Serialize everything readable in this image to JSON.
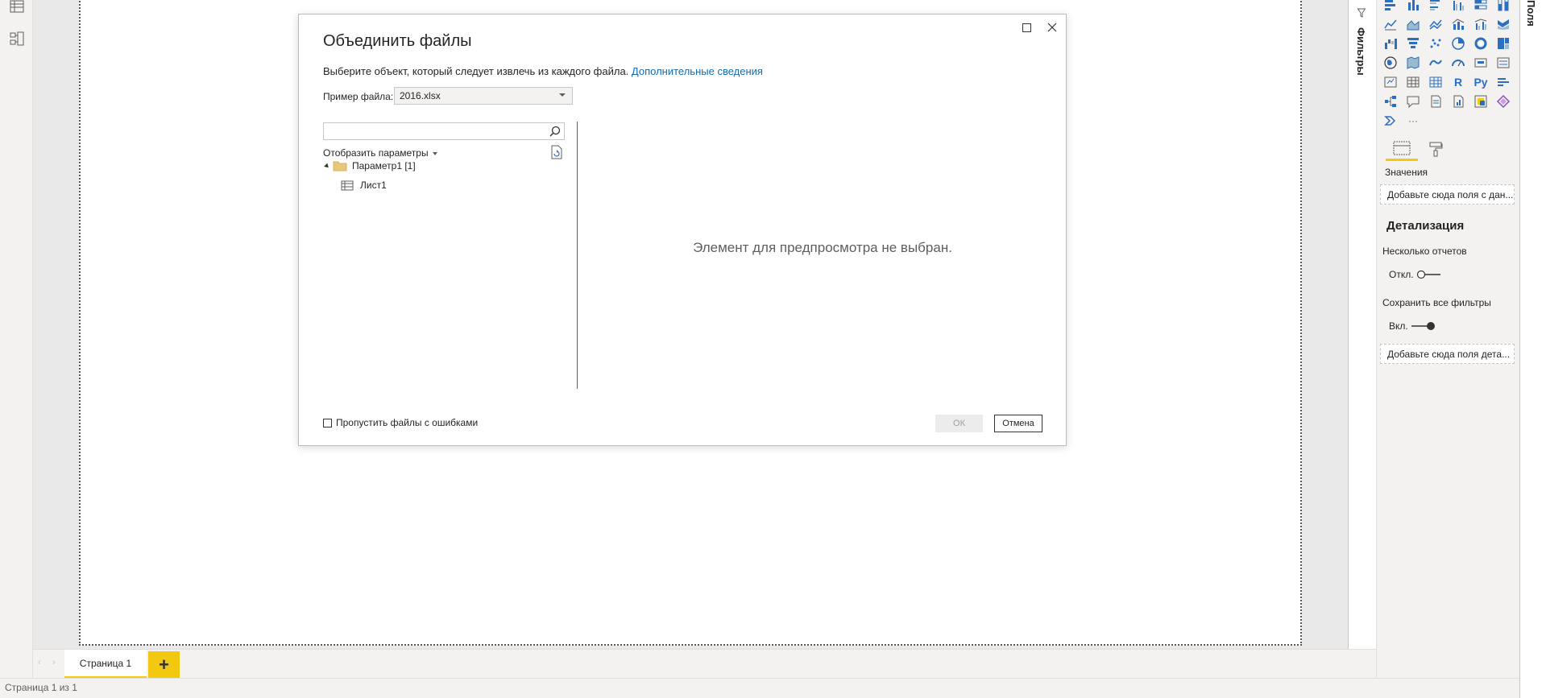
{
  "dialog": {
    "title": "Объединить файлы",
    "description": "Выберите объект, который следует извлечь из каждого файла.",
    "link": "Дополнительные сведения",
    "sample_file_label": "Пример файла:",
    "sample_file_value": "2016.xlsx",
    "show_params_label": "Отобразить параметры",
    "tree": [
      {
        "label": "Параметр1 [1]"
      },
      {
        "label": "Лист1"
      }
    ],
    "preview_empty": "Элемент для предпросмотра не выбран.",
    "skip_errors_label": "Пропустить файлы с ошибками",
    "ok_label": "ОК",
    "cancel_label": "Отмена"
  },
  "page_tabs": {
    "active": "Страница 1",
    "add": "+"
  },
  "status_bar": {
    "text": "Страница 1 из 1"
  },
  "filters_pane": {
    "label": "Фильтры"
  },
  "fields_pane": {
    "label": "Поля"
  },
  "viz_pane": {
    "values_label": "Значения",
    "values_well": "Добавьте сюда поля с дан...",
    "drillthrough_heading": "Детализация",
    "cross_report_label": "Несколько отчетов",
    "cross_report_state": "Откл.",
    "keep_filters_label": "Сохранить все фильтры",
    "keep_filters_state": "Вкл.",
    "drillthrough_well": "Добавьте сюда поля дета...",
    "r_visual": "R",
    "py_visual": "Py",
    "more": "···"
  },
  "colors": {
    "accent": "#f2c811",
    "link": "#166ab0",
    "viz_icon": "#2c6ebf"
  }
}
